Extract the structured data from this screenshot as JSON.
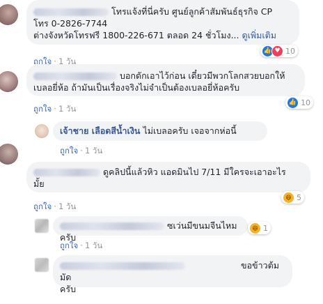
{
  "common": {
    "like": "ถูกใจ",
    "time": "1 วัน"
  },
  "comments": [
    {
      "text_line1": "โทรแจ้งที่นี่ครับ ศูนย์ลูกค้าสัมพันธ์ธุรกิจ CP",
      "text_line2": "โทร 0-2826-7744",
      "text_line3": "ต่างจังหวัดโทรฟรี 1800-226-671 ตลอด 24 ชั่วโมง...",
      "see_more": "ดูเพิ่มเติม",
      "reaction_count": "10",
      "reactions": [
        "like-icon",
        "love-icon"
      ]
    },
    {
      "text_line1": "บอกดักเอาไว้ก่อน เดี๋ยวมีพวกโลกสวยบอกให้",
      "text_line2": "เบลอยี่ห้อ ถ้ามันเป็นเรื่องจริงไม่จำเป็นต้องเบลอยี่ห้อครับ",
      "reaction_count": "10",
      "reactions": [
        "like-icon"
      ]
    },
    {
      "author": "เจ้าชาย เลือดสีน้ำเงิน",
      "text": "ไม่เบลอครับ เจอจากห่อนี้"
    },
    {
      "text_line1": "ดูคลิปนี้แล้วหิว แอดมินไป 7/11 มีใครจะเอาอะไร",
      "text_line2": "มั้ย",
      "reaction_count": "5",
      "reactions": [
        "haha-icon"
      ]
    },
    {
      "text": "ซเว่นมีขนมจีนไหมครับ",
      "reaction_count": "1",
      "reactions": [
        "haha-icon"
      ]
    },
    {
      "text_line1": "ขอข้าวต้มมัด",
      "text_line2": "ครับ"
    }
  ],
  "colors": {
    "link": "#385898",
    "bubble": "#f2f3f5",
    "meta": "#90949c",
    "like_blue": "#4267b2"
  }
}
